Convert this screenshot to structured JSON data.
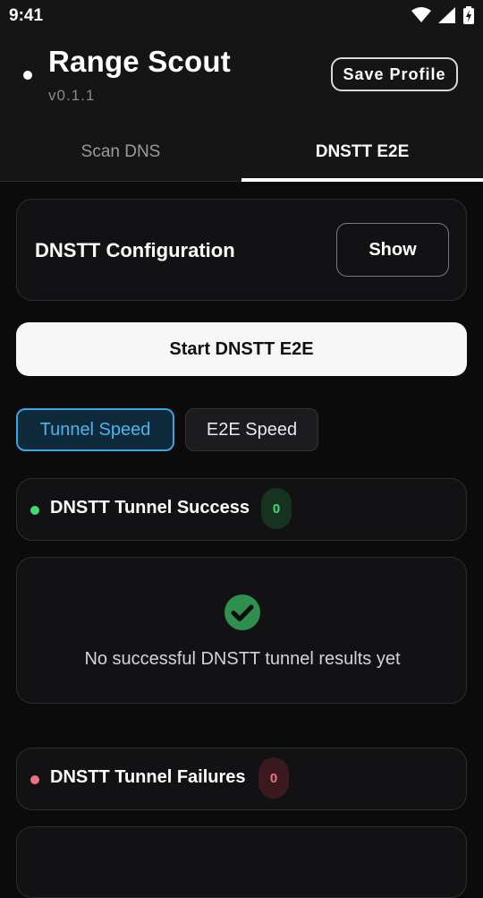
{
  "status_bar": {
    "time": "9:41",
    "icons": [
      "wifi-icon",
      "signal-icon",
      "battery-charging-icon"
    ]
  },
  "app": {
    "title": "Range Scout",
    "version": "v0.1.1",
    "save_profile_label": "Save Profile"
  },
  "tabs": [
    {
      "label": "Scan DNS",
      "selected": false
    },
    {
      "label": "DNSTT E2E",
      "selected": true
    }
  ],
  "config_card": {
    "title": "DNSTT Configuration",
    "show_label": "Show"
  },
  "start_button_label": "Start DNSTT E2E",
  "speed_tabs": [
    {
      "label": "Tunnel Speed",
      "selected": true
    },
    {
      "label": "E2E Speed",
      "selected": false
    }
  ],
  "sections": {
    "success": {
      "title": "DNSTT Tunnel Success",
      "count": "0",
      "empty_message": "No successful DNSTT tunnel results yet"
    },
    "failures": {
      "title": "DNSTT Tunnel Failures",
      "count": "0"
    }
  },
  "colors": {
    "accent_blue": "#3aa6df",
    "success_green": "#3ddc74",
    "failure_red": "#f07080",
    "check_circle": "#2f8f4e"
  }
}
